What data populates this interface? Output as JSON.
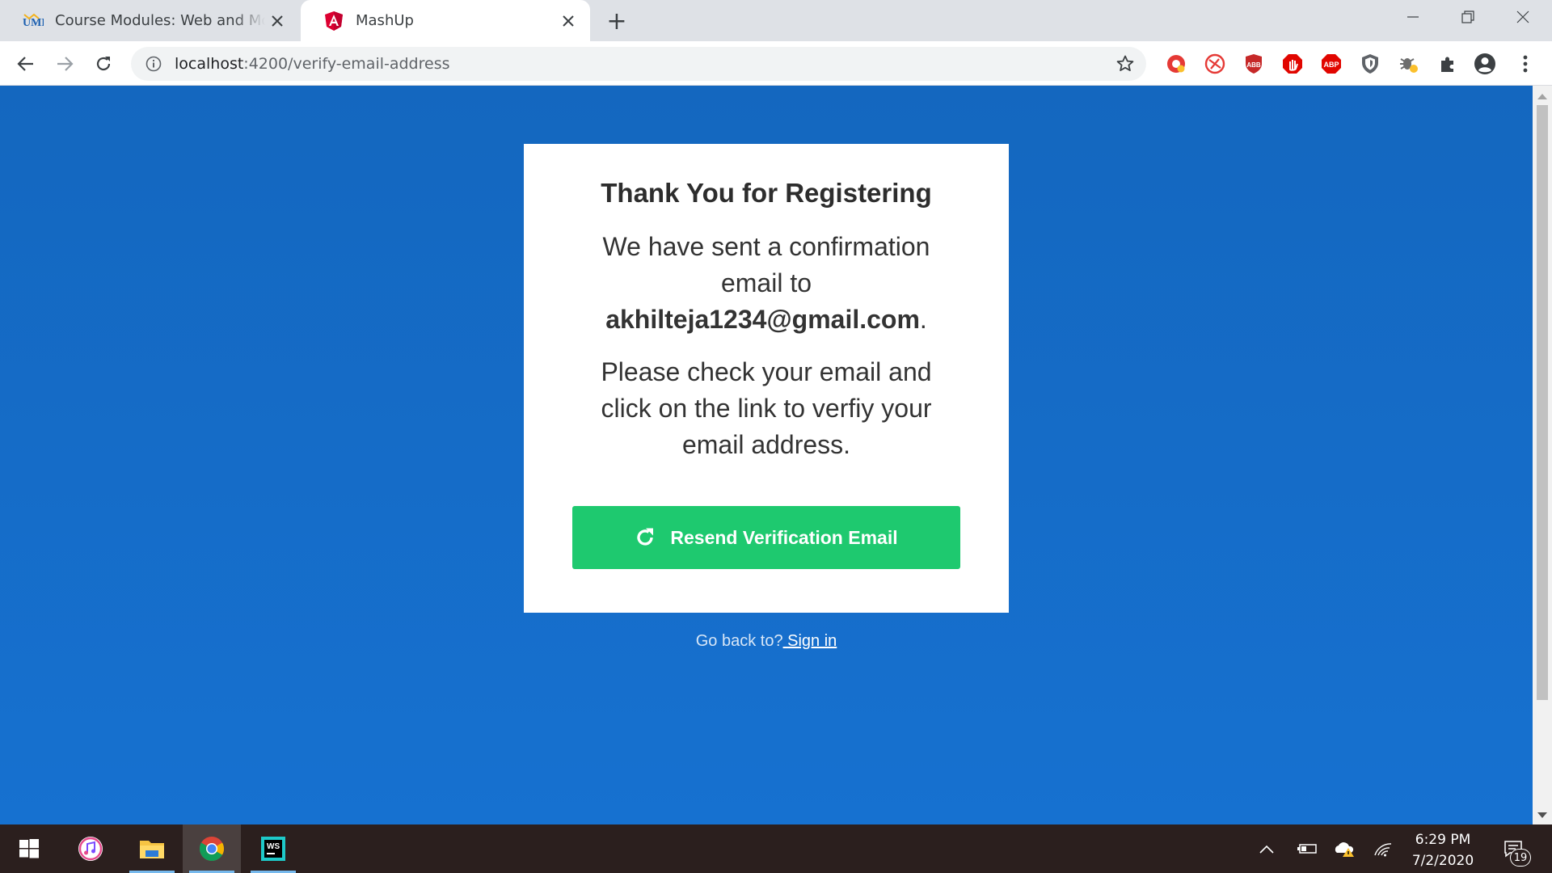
{
  "browser": {
    "tabs": [
      {
        "title": "Course Modules: Web and Mobile",
        "favicon": "umkc-logo-icon",
        "active": false
      },
      {
        "title": "MashUp",
        "favicon": "angular-icon",
        "active": true
      }
    ],
    "new_tab_label": "+",
    "url_host": "localhost",
    "url_path": ":4200/verify-email-address",
    "extensions": [
      "extension-red-1",
      "extension-red-2",
      "adblock-icon",
      "stop-hand-icon",
      "abp-icon",
      "shield-icon",
      "bug-icon",
      "puzzle-icon"
    ],
    "accent": "#1a73e8"
  },
  "page": {
    "heading": "Thank You for Registering",
    "confirm_prefix": "We have sent a confirmation email to ",
    "email": "akhilteja1234@gmail.com",
    "confirm_suffix": ".",
    "instructions": "Please check your email and click on the link to verfiy your email address.",
    "resend_label": "Resend Verification Email",
    "goback_prefix": "Go back to?",
    "signin_label": " Sign in",
    "background_color": "#1467bf",
    "button_color": "#1ec96f"
  },
  "taskbar": {
    "apps": [
      "windows-start-icon",
      "itunes-icon",
      "file-explorer-icon",
      "chrome-icon",
      "webstorm-icon"
    ],
    "time": "6:29 PM",
    "date": "7/2/2020",
    "notifications": "19"
  }
}
